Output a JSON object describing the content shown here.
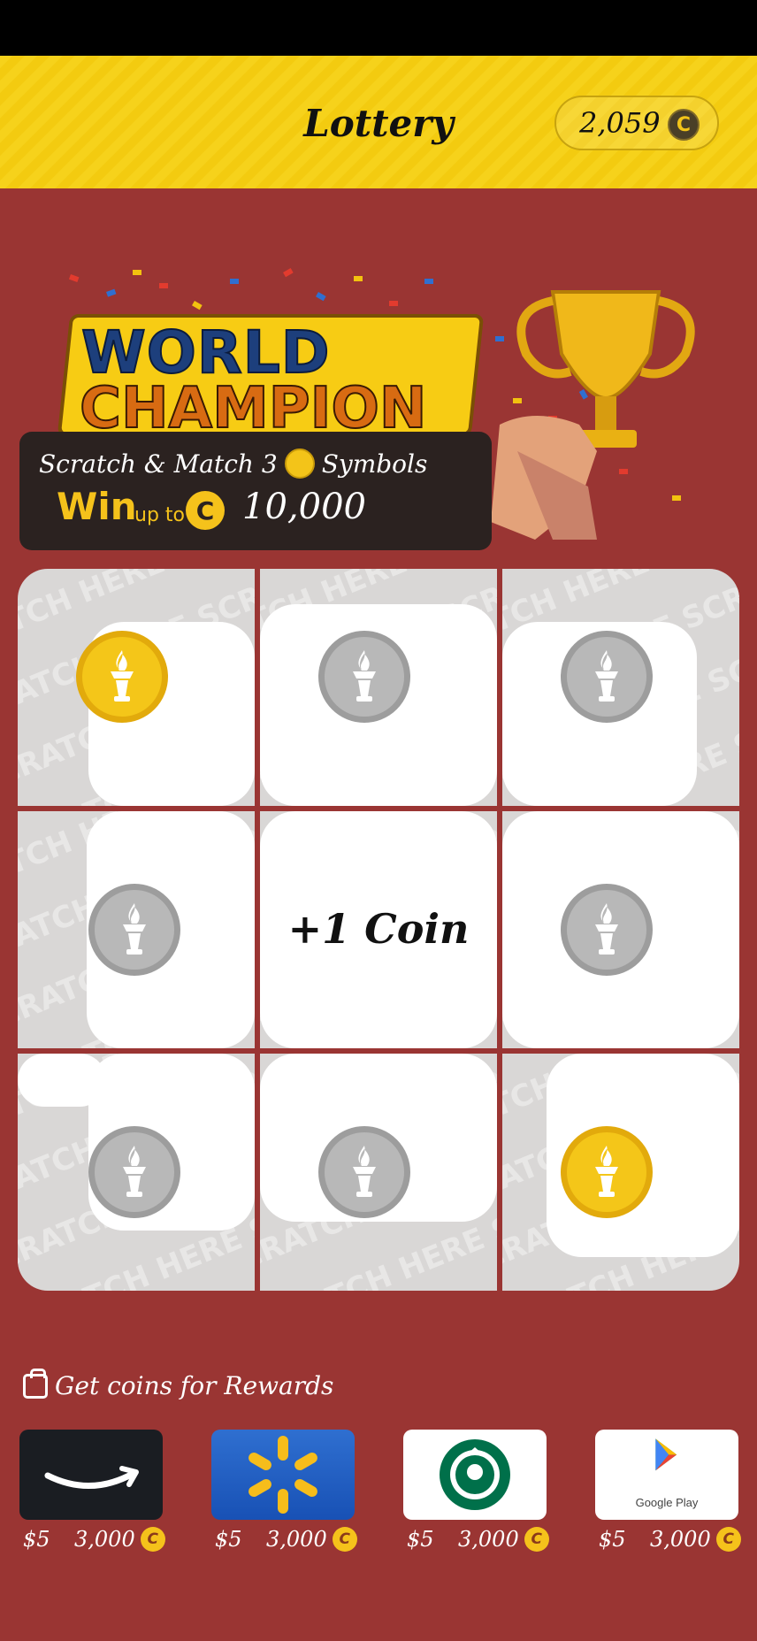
{
  "header": {
    "title": "Lottery",
    "balance": "2,059",
    "coin_symbol": "C"
  },
  "banner": {
    "logo_line1": "WORLD",
    "logo_line2": "CHAMPION",
    "promo_text": "Scratch & Match 3",
    "promo_symbols": "Symbols",
    "win_label": "Win",
    "win_upto": "up to",
    "win_amount": "10,000"
  },
  "scratch_card": {
    "watermark": "SCRATCH HERE SCRATCH HERE",
    "cells": [
      {
        "type": "symbol",
        "color": "gold"
      },
      {
        "type": "symbol",
        "color": "silver"
      },
      {
        "type": "symbol",
        "color": "silver"
      },
      {
        "type": "symbol",
        "color": "silver"
      },
      {
        "type": "text",
        "text": "+1 Coin"
      },
      {
        "type": "symbol",
        "color": "silver"
      },
      {
        "type": "symbol",
        "color": "silver"
      },
      {
        "type": "symbol",
        "color": "silver"
      },
      {
        "type": "symbol",
        "color": "gold"
      }
    ]
  },
  "rewards": {
    "title": "Get coins for Rewards",
    "items": [
      {
        "brand": "amazon-logo",
        "usd": "$5",
        "price": "3,000"
      },
      {
        "brand": "walmart-logo",
        "usd": "$5",
        "price": "3,000"
      },
      {
        "brand": "starbucks-logo",
        "usd": "$5",
        "price": "3,000"
      },
      {
        "brand": "google-play-logo",
        "usd": "$5",
        "price": "3,000",
        "label": "Google Play"
      }
    ]
  },
  "colors": {
    "background": "#9a3533",
    "header": "#f6d21b",
    "gold_coin": "#f4c619",
    "silver_coin": "#b8b8b8"
  }
}
